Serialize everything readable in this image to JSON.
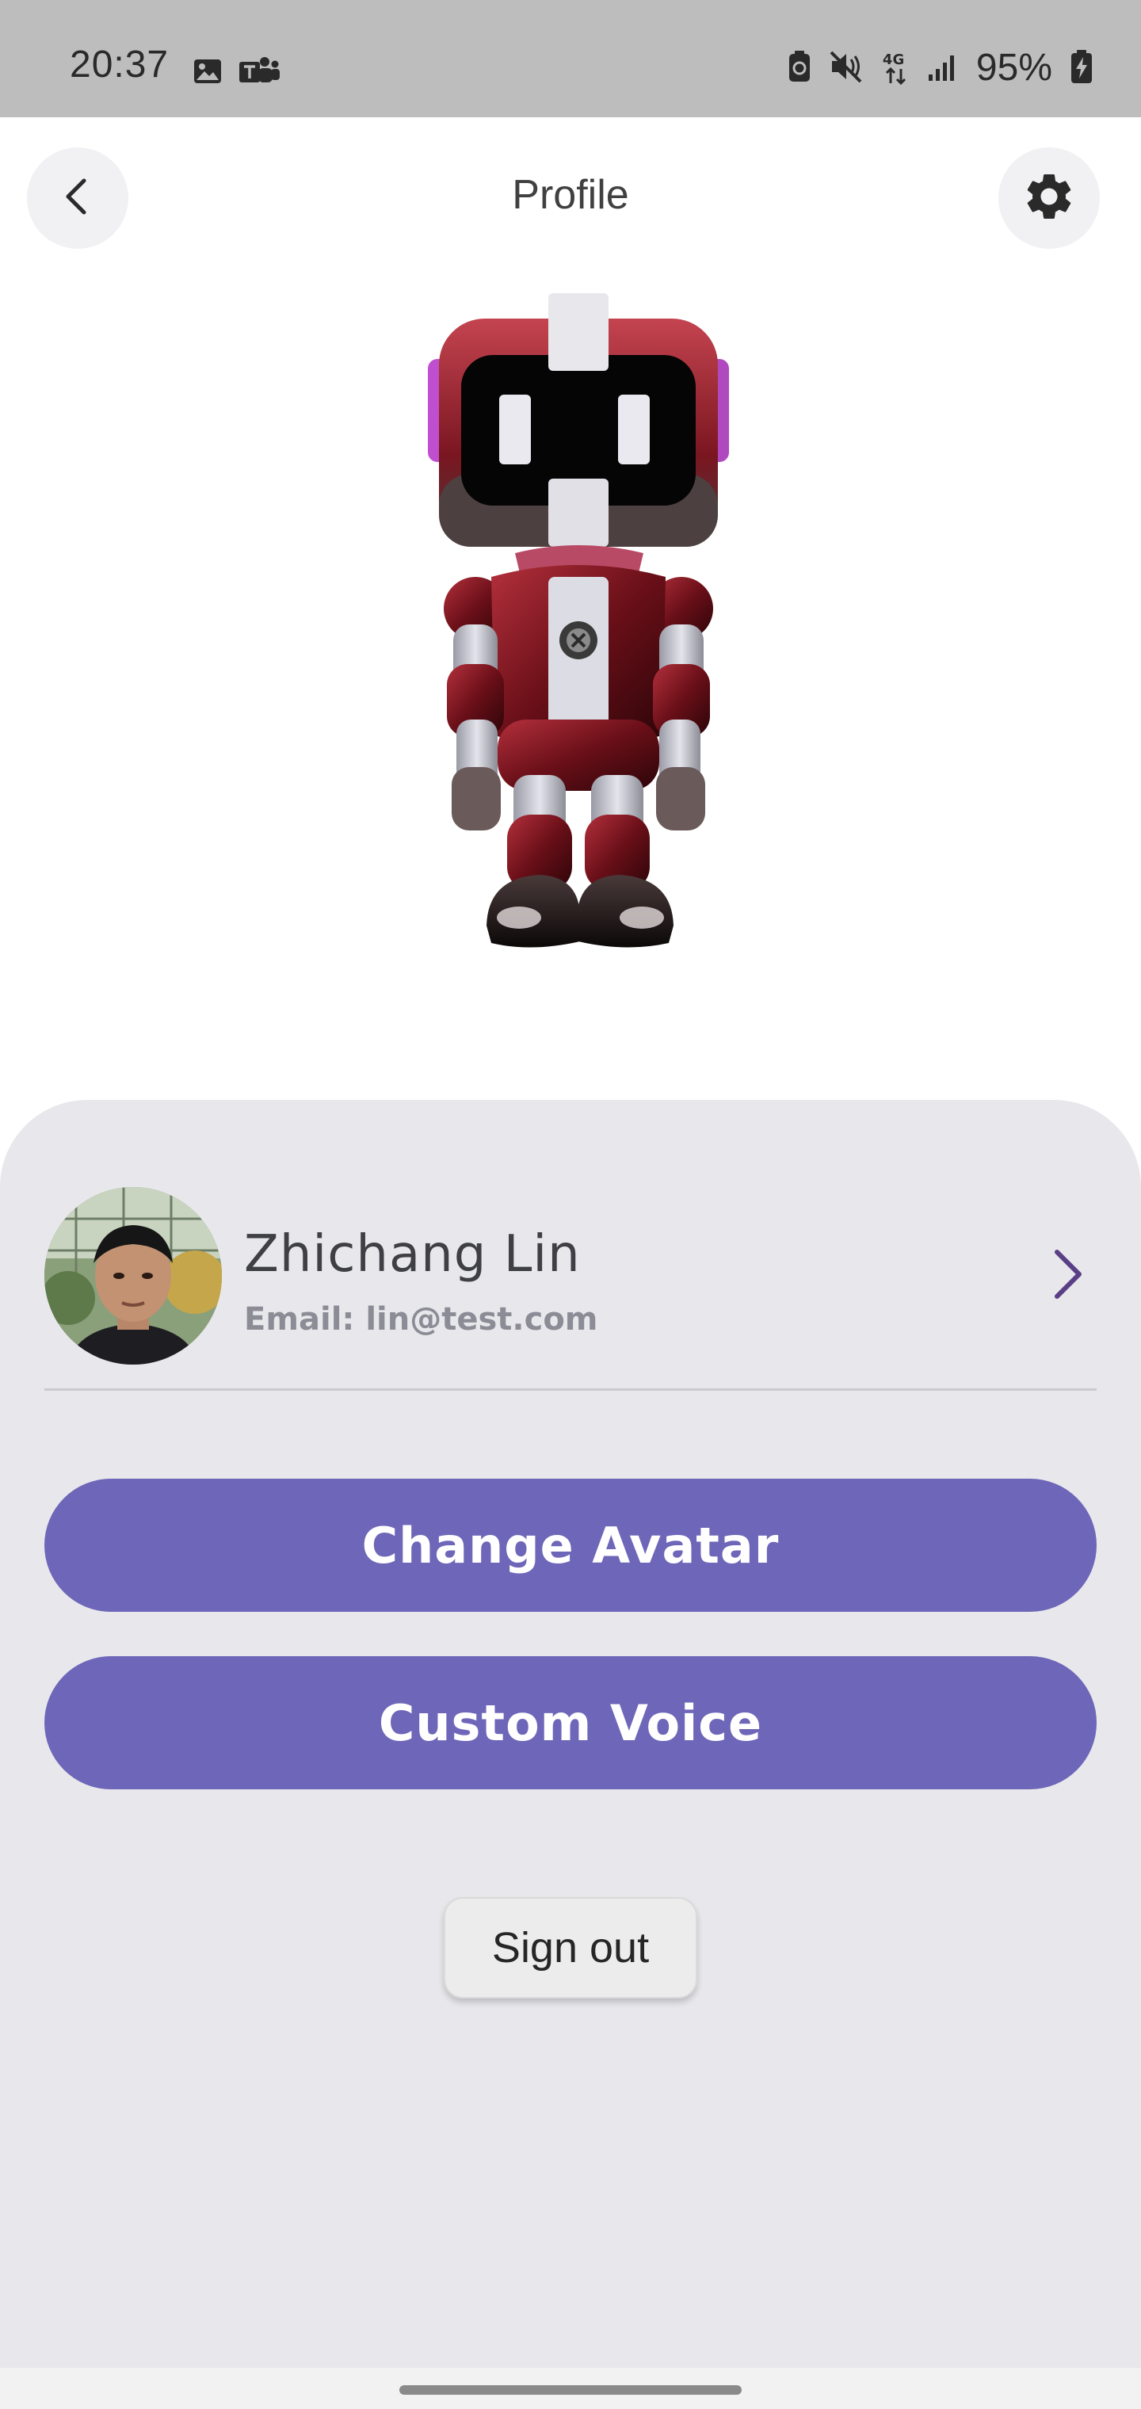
{
  "status_bar": {
    "time": "20:37",
    "battery_percent": "95%",
    "left_icons": [
      "gallery-icon",
      "teams-icon"
    ],
    "right_icons": [
      "battery-saver-icon",
      "mute-icon",
      "4g-signal-icon",
      "cell-signal-icon",
      "battery-charging-icon"
    ],
    "network_label": "4G"
  },
  "header": {
    "title": "Profile",
    "back_icon": "chevron-left-icon",
    "settings_icon": "gear-icon"
  },
  "avatar": {
    "description_name": "robot-avatar"
  },
  "profile": {
    "name": "Zhichang Lin",
    "email": "Email: lin@test.com",
    "chevron_icon": "chevron-right-icon"
  },
  "actions": {
    "change_avatar": "Change Avatar",
    "custom_voice": "Custom Voice",
    "sign_out": "Sign out"
  },
  "colors": {
    "accent": "#6e66b8",
    "panel_bg": "#e8e8ec",
    "status_bar_bg": "#bdbdbd"
  }
}
